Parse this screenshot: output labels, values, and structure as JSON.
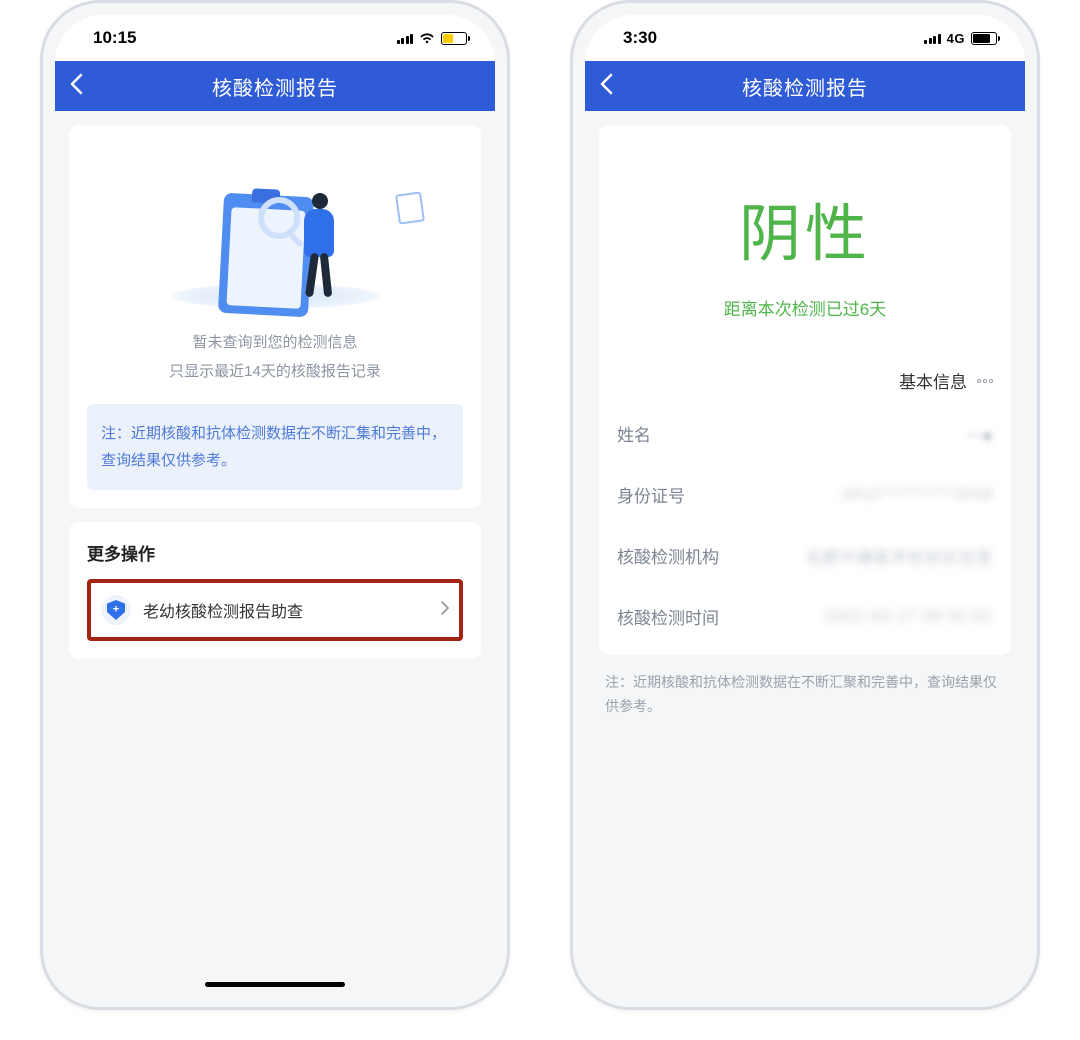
{
  "left": {
    "status": {
      "time": "10:15"
    },
    "nav": {
      "title": "核酸检测报告"
    },
    "empty": {
      "line1": "暂未查询到您的检测信息",
      "line2": "只显示最近14天的核酸报告记录"
    },
    "notice": "注：近期核酸和抗体检测数据在不断汇集和完善中，查询结果仅供参考。",
    "more": {
      "title": "更多操作",
      "action_label": "老幼核酸检测报告助查"
    }
  },
  "right": {
    "status": {
      "time": "3:30",
      "net": "4G"
    },
    "nav": {
      "title": "核酸检测报告"
    },
    "result": {
      "big": "阴性",
      "sub": "距离本次检测已过6天"
    },
    "section_title": "基本信息",
    "fields": {
      "name_label": "姓名",
      "name_value": "一■",
      "id_label": "身份证号",
      "id_value": "3412**********2018",
      "org_label": "核酸检测机构",
      "org_value": "合肥中康医学检验实验室",
      "time_label": "核酸检测时间",
      "time_value": "2022-02-17 09:32:01"
    },
    "footnote": "注：近期核酸和抗体检测数据在不断汇聚和完善中，查询结果仅供参考。"
  }
}
